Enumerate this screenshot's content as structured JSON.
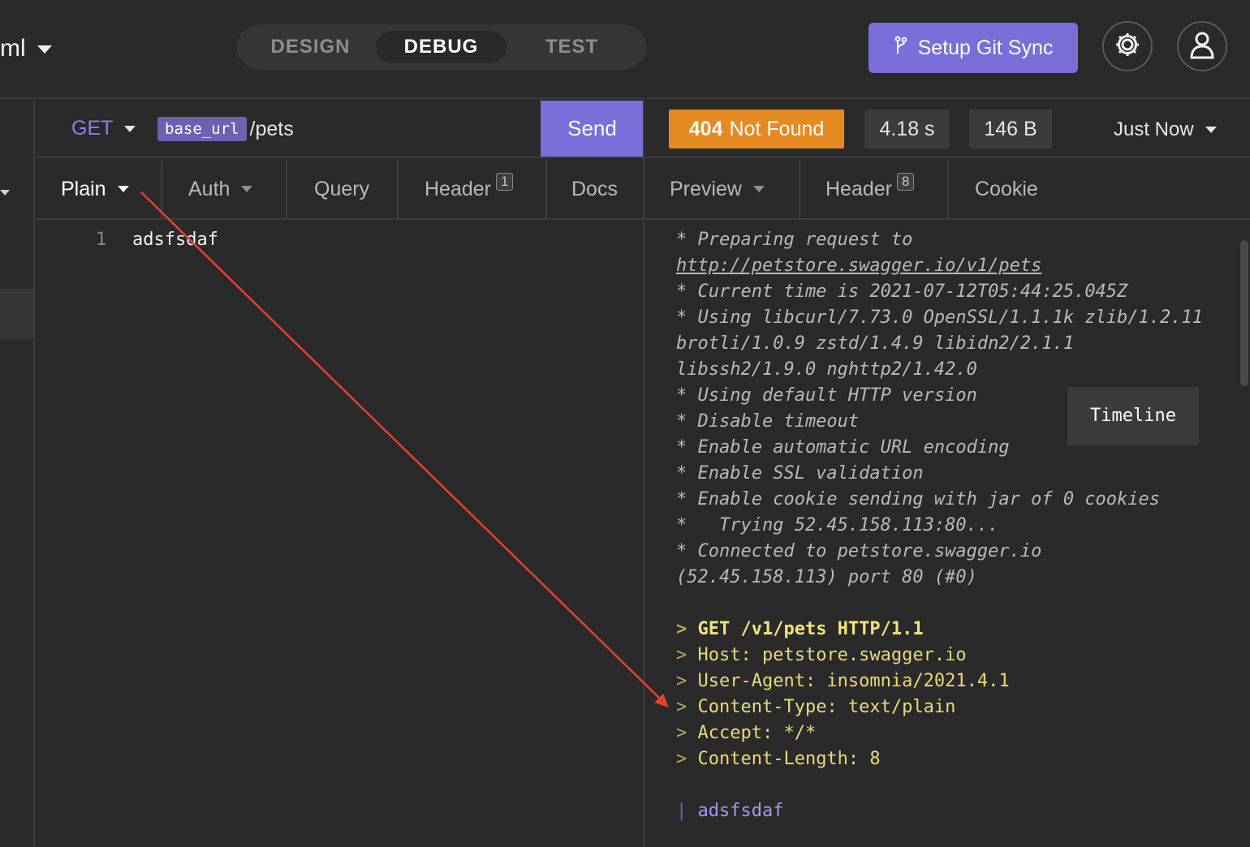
{
  "topbar": {
    "workspace_name": "ml",
    "modes": [
      "DESIGN",
      "DEBUG",
      "TEST"
    ],
    "active_mode": "DEBUG",
    "git_sync_label": "Setup Git Sync"
  },
  "request": {
    "method": "GET",
    "url_variable": "base_url",
    "url_path": "/pets",
    "send_label": "Send",
    "tabs": {
      "body": "Plain",
      "auth": "Auth",
      "query": "Query",
      "header": "Header",
      "header_count": "1",
      "docs": "Docs"
    },
    "editor": {
      "line_number": "1",
      "line_text": "adsfsdaf"
    }
  },
  "response": {
    "status_code": "404",
    "status_text": "Not Found",
    "time": "4.18 s",
    "size": "146 B",
    "timestamp": "Just Now",
    "tabs": {
      "preview": "Preview",
      "header": "Header",
      "header_count": "8",
      "cookie": "Cookie",
      "timeline": "Timeline"
    },
    "timeline": {
      "l1": "* Preparing request to",
      "l2": "http://petstore.swagger.io/v1/pets",
      "l3": "* Current time is 2021-07-12T05:44:25.045Z",
      "l4": "* Using libcurl/7.73.0 OpenSSL/1.1.1k zlib/1.2.11",
      "l5": "brotli/1.0.9 zstd/1.4.9 libidn2/2.1.1",
      "l6": "libssh2/1.9.0 nghttp2/1.42.0",
      "l7": "* Using default HTTP version",
      "l8": "* Disable timeout",
      "l9": "* Enable automatic URL encoding",
      "l10": "* Enable SSL validation",
      "l11": "* Enable cookie sending with jar of 0 cookies",
      "l12": "*   Trying 52.45.158.113:80...",
      "l13": "* Connected to petstore.swagger.io",
      "l14": "(52.45.158.113) port 80 (#0)",
      "o1": "GET /v1/pets HTTP/1.1",
      "o2": "Host: petstore.swagger.io",
      "o3": "User-Agent: insomnia/2021.4.1",
      "o4": "Content-Type: text/plain",
      "o5": "Accept: */*",
      "o6": "Content-Length: 8",
      "body": "adsfsdaf"
    }
  },
  "colors": {
    "accent": "#7a6ed8",
    "status_404": "#e58a21",
    "annotation_arrow": "#e8402e"
  }
}
